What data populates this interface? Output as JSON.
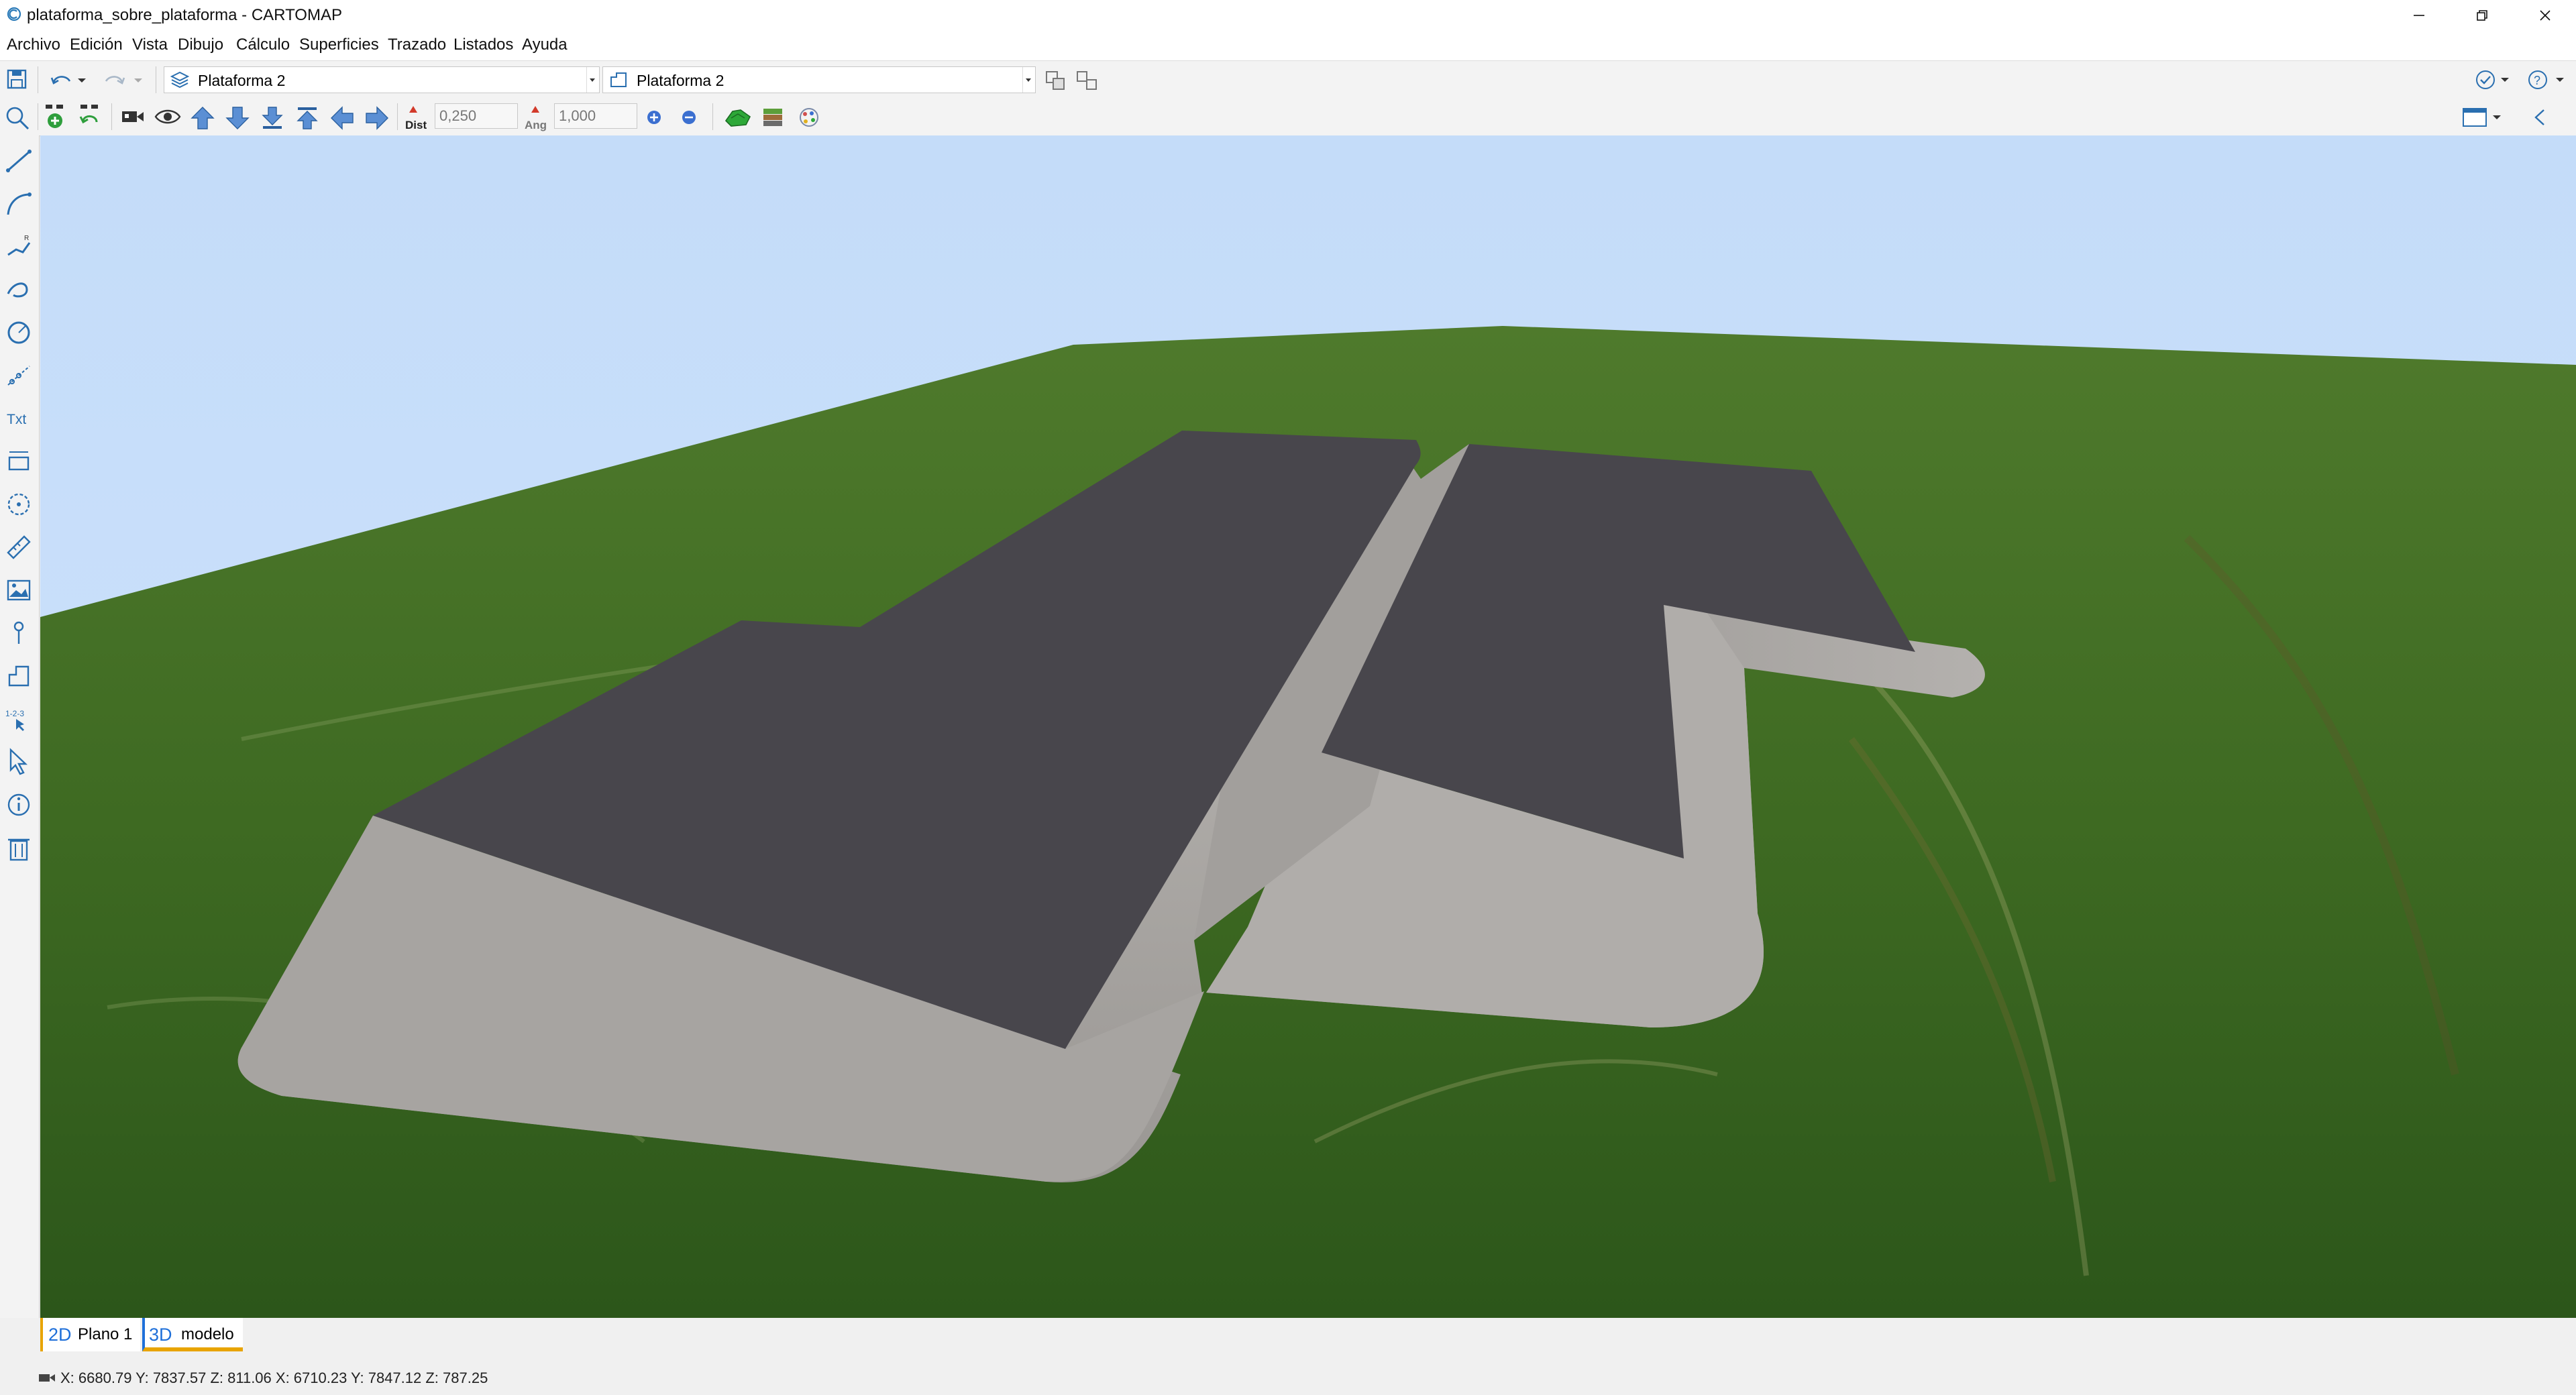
{
  "window": {
    "title": "plataforma_sobre_plataforma - CARTOMAP",
    "app_icon": "cartomap-logo-icon"
  },
  "menu": [
    "Archivo",
    "Edición",
    "Vista",
    "Dibujo",
    "Cálculo",
    "Superficies",
    "Trazado",
    "Listados",
    "Ayuda"
  ],
  "toolbar": {
    "layer_combo": "Plataforma 2",
    "platform_combo": "Plataforma 2",
    "dist_label": "Dist",
    "dist_value": "0,250",
    "ang_label": "Ang",
    "ang_value": "1,000"
  },
  "left_toolbar": {
    "text_tool": "Txt",
    "numbering_tool": "1-2-3"
  },
  "tabs": [
    {
      "prefix": "2D",
      "label": "Plano 1",
      "accent": "#1e6fd9",
      "underline": "#e8a400"
    },
    {
      "prefix": "3D",
      "label": "modelo",
      "accent": "#1e6fd9",
      "underline": "#e8a400"
    }
  ],
  "status": {
    "coordinates": "X: 6680.79  Y: 7837.57  Z: 811.06    X: 6710.23  Y: 7847.12  Z: 787.25"
  },
  "colors": {
    "sky": "#c4dcf9",
    "terrain": "#3e6a22",
    "platform_top": "#48464c",
    "embankment": "#a5a2a0"
  }
}
